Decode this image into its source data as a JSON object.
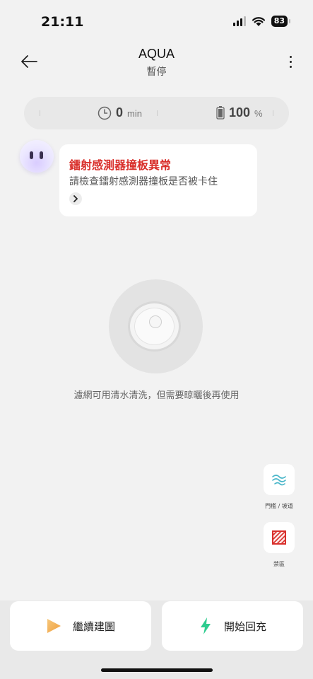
{
  "status_bar": {
    "time": "21:11",
    "battery": "83"
  },
  "header": {
    "title": "AQUA",
    "subtitle": "暫停"
  },
  "stats": {
    "time_value": "0",
    "time_unit": "min",
    "battery_value": "100",
    "battery_unit": "%"
  },
  "alert": {
    "title": "鐳射感測器撞板異常",
    "body": "請檢查鐳射感測器撞板是否被卡住"
  },
  "robot": {
    "caption": "濾網可用清水清洗，但需要晾曬後再使用"
  },
  "side_tools": [
    {
      "label": "門檻 / 坡道",
      "icon": "threshold-ramp-icon"
    },
    {
      "label": "禁區",
      "icon": "no-go-zone-icon"
    }
  ],
  "actions": {
    "continue_label": "繼續建圖",
    "recharge_label": "開始回充"
  },
  "colors": {
    "alert_red": "#d9302c",
    "recharge_green": "#2ecc8f",
    "play_orange": "#f2b25c"
  }
}
